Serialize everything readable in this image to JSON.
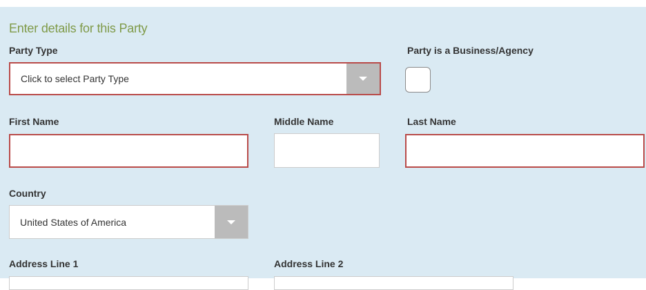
{
  "form": {
    "heading": "Enter details for this Party",
    "party_type": {
      "label": "Party Type",
      "selected": "Click to select Party Type",
      "icon": "chevron-down-icon"
    },
    "business_agency": {
      "label": "Party is a Business/Agency",
      "checked": false
    },
    "first_name": {
      "label": "First Name",
      "value": ""
    },
    "middle_name": {
      "label": "Middle Name",
      "value": ""
    },
    "last_name": {
      "label": "Last Name",
      "value": ""
    },
    "country": {
      "label": "Country",
      "selected": "United States of America",
      "icon": "chevron-down-icon"
    },
    "address_line_1": {
      "label": "Address Line 1"
    },
    "address_line_2": {
      "label": "Address Line 2"
    }
  },
  "colors": {
    "panel_background": "#daeaf3",
    "heading_text": "#7f9a48",
    "required_border": "#b94a48",
    "dropdown_arrow_background": "#bbbbbb"
  }
}
